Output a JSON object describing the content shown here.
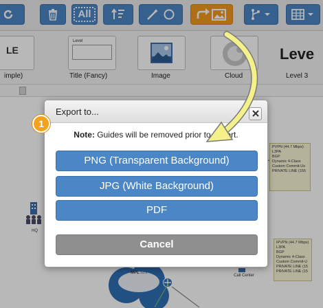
{
  "toolbar": {
    "all_label": "All",
    "buttons": [
      {
        "name": "undo-icon"
      },
      {
        "name": "trash-icon"
      },
      {
        "name": "select-all-button"
      },
      {
        "name": "sort-layers-icon"
      },
      {
        "name": "magic-wand-icon"
      },
      {
        "name": "export-image-icon"
      },
      {
        "name": "connector-icon"
      },
      {
        "name": "table-icon"
      }
    ],
    "colors": {
      "primary": "#4b87c7",
      "export_active": "#f39a1f"
    }
  },
  "library": {
    "items": [
      {
        "label": "imple)",
        "thumb_text": "LE"
      },
      {
        "label": "Title (Fancy)",
        "thumb_text": "Level"
      },
      {
        "label": "Image"
      },
      {
        "label": "Cloud"
      },
      {
        "label": "Level 3",
        "thumb_text": "Leve"
      }
    ]
  },
  "canvas": {
    "nodes": [
      {
        "label": "HQ"
      },
      {
        "label": "Call Center"
      },
      {
        "label": "MPL",
        "sub": "CO-S"
      }
    ],
    "boxes": [
      {
        "lines": [
          "PVPN (44.7 Mbps)",
          "L3PA",
          "BGP",
          "Dynamic 4-Class",
          "Custom Commit-Us",
          "PRIVATE LINE (155"
        ]
      },
      {
        "lines": [
          "IPVPN (44.7 Mbps)",
          "L3PA",
          "BGP",
          "Dynamic 4-Class",
          "Custom Commit-U",
          "PRIVATE LINE (15",
          "PRIVATE LINE (15"
        ]
      }
    ]
  },
  "dialog": {
    "title": "Export to...",
    "note_bold": "Note:",
    "note_text": " Guides will be removed prior to export.",
    "buttons": {
      "png": "PNG (Transparent Background)",
      "jpg": "JPG (White Background)",
      "pdf": "PDF",
      "cancel": "Cancel"
    }
  },
  "annotation": {
    "step": "1",
    "arrow_color": "#f4f08a"
  }
}
